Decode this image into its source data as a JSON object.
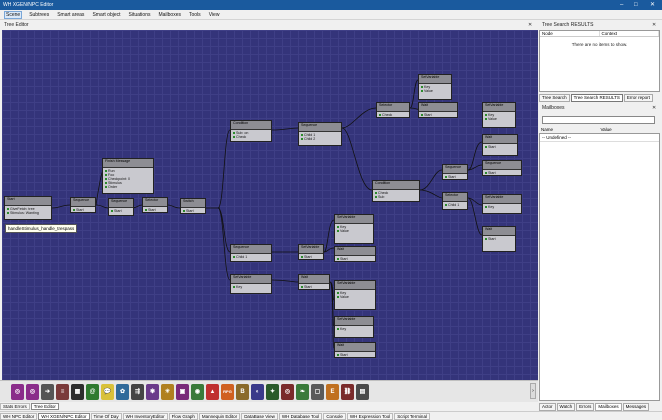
{
  "window": {
    "title": "WH XGEN/NPC Editor",
    "controls": [
      "–",
      "□",
      "✕"
    ]
  },
  "menu": [
    "Scene",
    "Subtrees",
    "Smart areas",
    "Smart object",
    "Situations",
    "Mailboxes",
    "Tools",
    "View"
  ],
  "tree_editor": {
    "title": "Tree Editor",
    "tooltip": "handleStimulus_handle_trespass"
  },
  "nodes": [
    {
      "title": "Start",
      "lines": [
        "Start",
        "GiveFetch: tree",
        "Stimulus: Wanting"
      ]
    },
    {
      "title": "Sequence",
      "lines": [
        "Start"
      ]
    },
    {
      "title": "Finish Message",
      "lines": [
        "Run",
        "Foo",
        "Checkpoint: 0",
        "Stimulus",
        "Order"
      ]
    },
    {
      "title": "Sequence",
      "lines": [
        "Start",
        "Child 1"
      ]
    },
    {
      "title": "Selector",
      "lines": [
        "Start"
      ]
    },
    {
      "title": "Switch",
      "lines": [
        "Start"
      ]
    },
    {
      "title": "Condition",
      "lines": [
        "Start",
        "Sub: on",
        "Check"
      ]
    },
    {
      "title": "Sequence",
      "lines": [
        "Start",
        "Child 1",
        "Child 2"
      ]
    },
    {
      "title": "Selector",
      "lines": [
        "Start",
        "Check"
      ]
    },
    {
      "title": "Sequence",
      "lines": [
        "Start",
        "Child 1"
      ]
    },
    {
      "title": "SetVariable",
      "lines": [
        "Start",
        "Key",
        "Value"
      ]
    },
    {
      "title": "Wait",
      "lines": [
        "Start"
      ]
    },
    {
      "title": "Condition",
      "lines": [
        "Start",
        "Check",
        "Sub"
      ]
    },
    {
      "title": "Sequence",
      "lines": [
        "Start",
        "Child 1"
      ]
    },
    {
      "title": "Selector",
      "lines": [
        "Start",
        "Child 1",
        "Child 2"
      ]
    },
    {
      "title": "SetVariable",
      "lines": [
        "Start",
        "Key",
        "Value"
      ]
    },
    {
      "title": "Wait",
      "lines": [
        "Start"
      ]
    },
    {
      "title": "Sequence",
      "lines": [
        "Start",
        "Child 1"
      ]
    },
    {
      "title": "SetVariable",
      "lines": [
        "Start",
        "Key",
        "Value"
      ]
    },
    {
      "title": "Wait",
      "lines": [
        "Start"
      ]
    },
    {
      "title": "Sequence",
      "lines": [
        "Start",
        "Child 1"
      ]
    },
    {
      "title": "SetVariable",
      "lines": [
        "Start",
        "Key",
        "Value"
      ]
    },
    {
      "title": "SetVariable",
      "lines": [
        "Start",
        "Key",
        "Value"
      ]
    },
    {
      "title": "Wait",
      "lines": [
        "Start"
      ]
    },
    {
      "title": "SetVariable",
      "lines": [
        "Start",
        "Key",
        "Value"
      ]
    },
    {
      "title": "Wait",
      "lines": [
        "Start"
      ]
    },
    {
      "title": "SetVariable",
      "lines": [
        "Start",
        "Key",
        "Value"
      ]
    }
  ],
  "palette": [
    {
      "icon": "ring-icon",
      "color": "#8a2c8a",
      "glyph": "◎"
    },
    {
      "icon": "ring-icon",
      "color": "#8a2c8a",
      "glyph": "◎"
    },
    {
      "icon": "arrow-icon",
      "color": "#555555",
      "glyph": "➔"
    },
    {
      "icon": "lines-icon",
      "color": "#7a3a3a",
      "glyph": "≡"
    },
    {
      "icon": "grid-icon",
      "color": "#2d2d2d",
      "glyph": "▦"
    },
    {
      "icon": "spiral-icon",
      "color": "#2f7a2f",
      "glyph": "@"
    },
    {
      "icon": "bubble-icon",
      "color": "#d8c13a",
      "glyph": "💬"
    },
    {
      "icon": "gear-icon",
      "color": "#2f6a9a",
      "glyph": "✿"
    },
    {
      "icon": "arrow-icon",
      "color": "#444444",
      "glyph": "⇶"
    },
    {
      "icon": "flower-icon",
      "color": "#6a3a8a",
      "glyph": "✾"
    },
    {
      "icon": "sun-icon",
      "color": "#b08020",
      "glyph": "☀"
    },
    {
      "icon": "square-icon",
      "color": "#7a2a7a",
      "glyph": "▣"
    },
    {
      "icon": "ring-icon",
      "color": "#3a7a3a",
      "glyph": "◉"
    },
    {
      "icon": "shield-icon",
      "color": "#c03030",
      "glyph": "▲"
    },
    {
      "icon": "rpg-icon",
      "color": "#d06020",
      "glyph": "RPG"
    },
    {
      "icon": "b-icon",
      "color": "#8a6a2a",
      "glyph": "B"
    },
    {
      "icon": "circle-icon",
      "color": "#3a3a8a",
      "glyph": "◐"
    },
    {
      "icon": "star-icon",
      "color": "#2a5a2a",
      "glyph": "✦"
    },
    {
      "icon": "ring-icon",
      "color": "#7a2a2a",
      "glyph": "◎"
    },
    {
      "icon": "leaf-icon",
      "color": "#3a7a3a",
      "glyph": "❧"
    },
    {
      "icon": "frame-icon",
      "color": "#5a5a5a",
      "glyph": "▢"
    },
    {
      "icon": "e-icon",
      "color": "#c07020",
      "glyph": "E"
    },
    {
      "icon": "link-icon",
      "color": "#7a2a2a",
      "glyph": "⛓"
    },
    {
      "icon": "grid-icon",
      "color": "#4a4a4a",
      "glyph": "▤"
    }
  ],
  "bottom_tabs_top": [
    "Stats Errors",
    "Tree Editor"
  ],
  "bottom_tabs": [
    "WH NPC Editor",
    "WH XGEN/NPC Editor",
    "Time Of Day",
    "WH InventoryEditor",
    "Flow Graph",
    "Mannequin Editor",
    "DataBase View",
    "WH Database Tool",
    "Console",
    "WH Expression Tool",
    "Script Terminal"
  ],
  "tree_search": {
    "title": "Tree Search RESULTS",
    "col_node": "Node",
    "col_context": "Context",
    "empty_text": "There are no items to show.",
    "tabs": [
      "Tree Search",
      "Tree Search RESULTS",
      "Error report"
    ]
  },
  "mailboxes": {
    "title": "Mailboxes",
    "col_name": "Name",
    "col_value": "Value",
    "undefined_text": "-- Undefined --"
  },
  "right_tabs": [
    "Actor",
    "Watch",
    "Errors",
    "Mailboxes",
    "Messages"
  ]
}
